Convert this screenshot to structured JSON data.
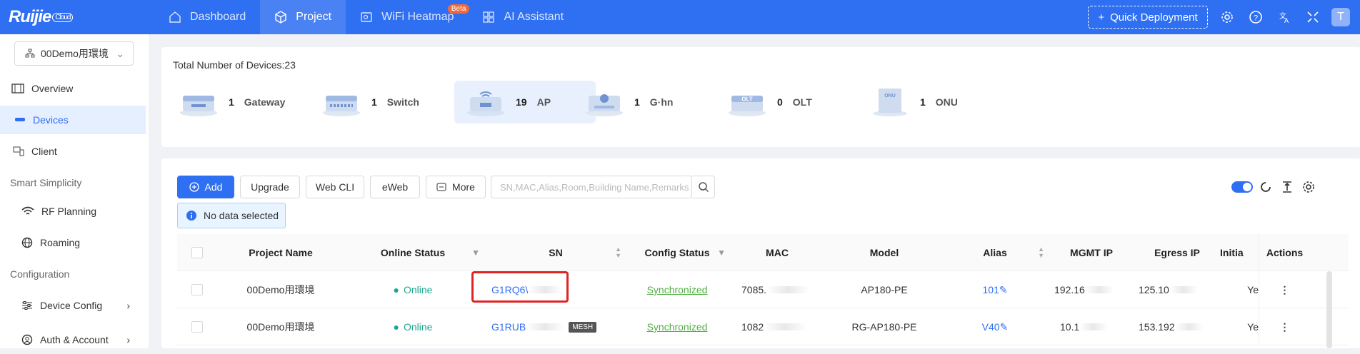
{
  "app": {
    "logo": "Ruijie",
    "logo_badge": "Cloud"
  },
  "nav": [
    {
      "label": "Dashboard",
      "active": false
    },
    {
      "label": "Project",
      "active": true
    },
    {
      "label": "WiFi Heatmap",
      "active": false,
      "badge": "Beta"
    },
    {
      "label": "AI Assistant",
      "active": false
    }
  ],
  "topbar": {
    "quick_deploy": "Quick Deployment",
    "avatar": "T"
  },
  "sidebar": {
    "project": "00Demo用環境",
    "items": [
      {
        "label": "Overview"
      },
      {
        "label": "Devices"
      },
      {
        "label": "Client"
      },
      {
        "label": "RF Planning"
      },
      {
        "label": "Roaming"
      },
      {
        "label": "Device Config"
      },
      {
        "label": "Auth & Account"
      }
    ],
    "groups": [
      "Smart Simplicity",
      "Configuration"
    ]
  },
  "summary": {
    "total": "Total Number of Devices:23",
    "types": [
      {
        "count": "1",
        "label": "Gateway"
      },
      {
        "count": "1",
        "label": "Switch"
      },
      {
        "count": "19",
        "label": "AP"
      },
      {
        "count": "1",
        "label": "G·hn"
      },
      {
        "count": "0",
        "label": "OLT"
      },
      {
        "count": "1",
        "label": "ONU"
      }
    ]
  },
  "toolbar": {
    "add": "Add",
    "upgrade": "Upgrade",
    "webcli": "Web CLI",
    "eweb": "eWeb",
    "more": "More",
    "search_placeholder": "SN,MAC,Alias,Room,Building Name,Remarks",
    "no_data": "No data selected"
  },
  "table": {
    "columns": [
      "Project Name",
      "Online Status",
      "SN",
      "Config Status",
      "MAC",
      "Model",
      "Alias",
      "MGMT IP",
      "Egress IP",
      "Initia",
      "Actions"
    ],
    "rows": [
      {
        "project": "00Demo用環境",
        "status": "Online",
        "sn": "G1RQ6\\",
        "config": "Synchronized",
        "mac": "7085.",
        "model": "AP180-PE",
        "alias": "101",
        "mgmt_ip": "192.16",
        "egress_ip": "125.10",
        "init": "Ye",
        "actions": "⋮"
      },
      {
        "project": "00Demo用環境",
        "status": "Online",
        "sn": "G1RUB",
        "mesh": "MESH",
        "config": "Synchronized",
        "mac": "1082",
        "model": "RG-AP180-PE",
        "alias": "V40",
        "mgmt_ip": "10.1",
        "egress_ip": "153.192",
        "init": "Ye",
        "actions": "⋮"
      }
    ]
  },
  "colors": {
    "primary": "#2f6ff1",
    "online": "#1fa88f",
    "synced": "#52b044",
    "highlight": "#e02424"
  }
}
